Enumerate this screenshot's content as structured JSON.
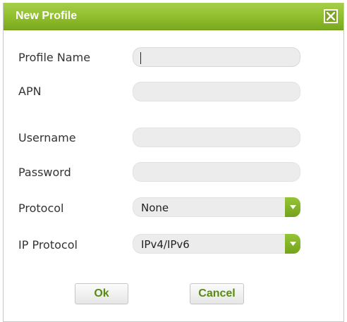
{
  "dialog": {
    "title": "New Profile",
    "close_icon": "close-icon"
  },
  "form": {
    "profile_name": {
      "label": "Profile Name",
      "value": ""
    },
    "apn": {
      "label": "APN",
      "value": ""
    },
    "username": {
      "label": "Username",
      "value": ""
    },
    "password": {
      "label": "Password",
      "value": ""
    },
    "protocol": {
      "label": "Protocol",
      "selected": "None"
    },
    "ip_protocol": {
      "label": "IP Protocol",
      "selected": "IPv4/IPv6"
    }
  },
  "buttons": {
    "ok": "Ok",
    "cancel": "Cancel"
  },
  "colors": {
    "title_bar": "#8fbd2c",
    "button_text": "#5a8a14",
    "field_bg": "#ececec"
  }
}
